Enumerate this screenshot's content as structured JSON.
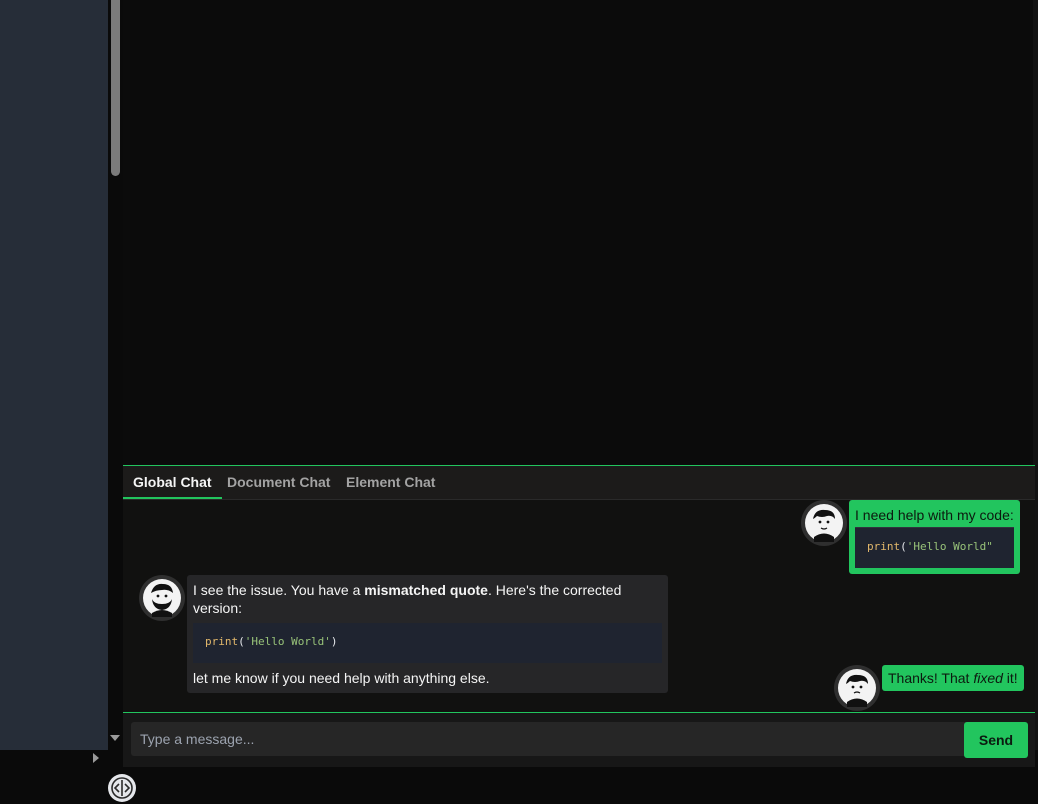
{
  "chat": {
    "tabs": [
      "Global Chat",
      "Document Chat",
      "Element Chat"
    ],
    "messages": [
      {
        "from": "user",
        "text": "I need help with my code:",
        "code_fn": "print",
        "code_open": "(",
        "code_str": "'Hello World\"",
        "code_close": ""
      },
      {
        "from": "assistant",
        "text_before": "I see the issue. You have a ",
        "text_bold": "mismatched quote",
        "text_after": ". Here's the corrected version:",
        "code_fn": "print",
        "code_open": "(",
        "code_str": "'Hello World'",
        "code_close": ")",
        "text_tail": "let me know if you need help with anything else."
      },
      {
        "from": "user",
        "text_before": "Thanks! That ",
        "text_em": "fixed",
        "text_after": " it!"
      }
    ],
    "input": {
      "placeholder": "Type a message...",
      "value": ""
    },
    "send_label": "Send"
  },
  "colors": {
    "accent": "#22c55e",
    "sidebar": "#262d38",
    "chat_background": "#111110",
    "bubble_ai": "#262628"
  },
  "icons": [
    "user-avatar-icon",
    "assistant-avatar-icon",
    "split-handle-icon",
    "scroll-down-arrow-icon",
    "expand-arrow-icon"
  ]
}
